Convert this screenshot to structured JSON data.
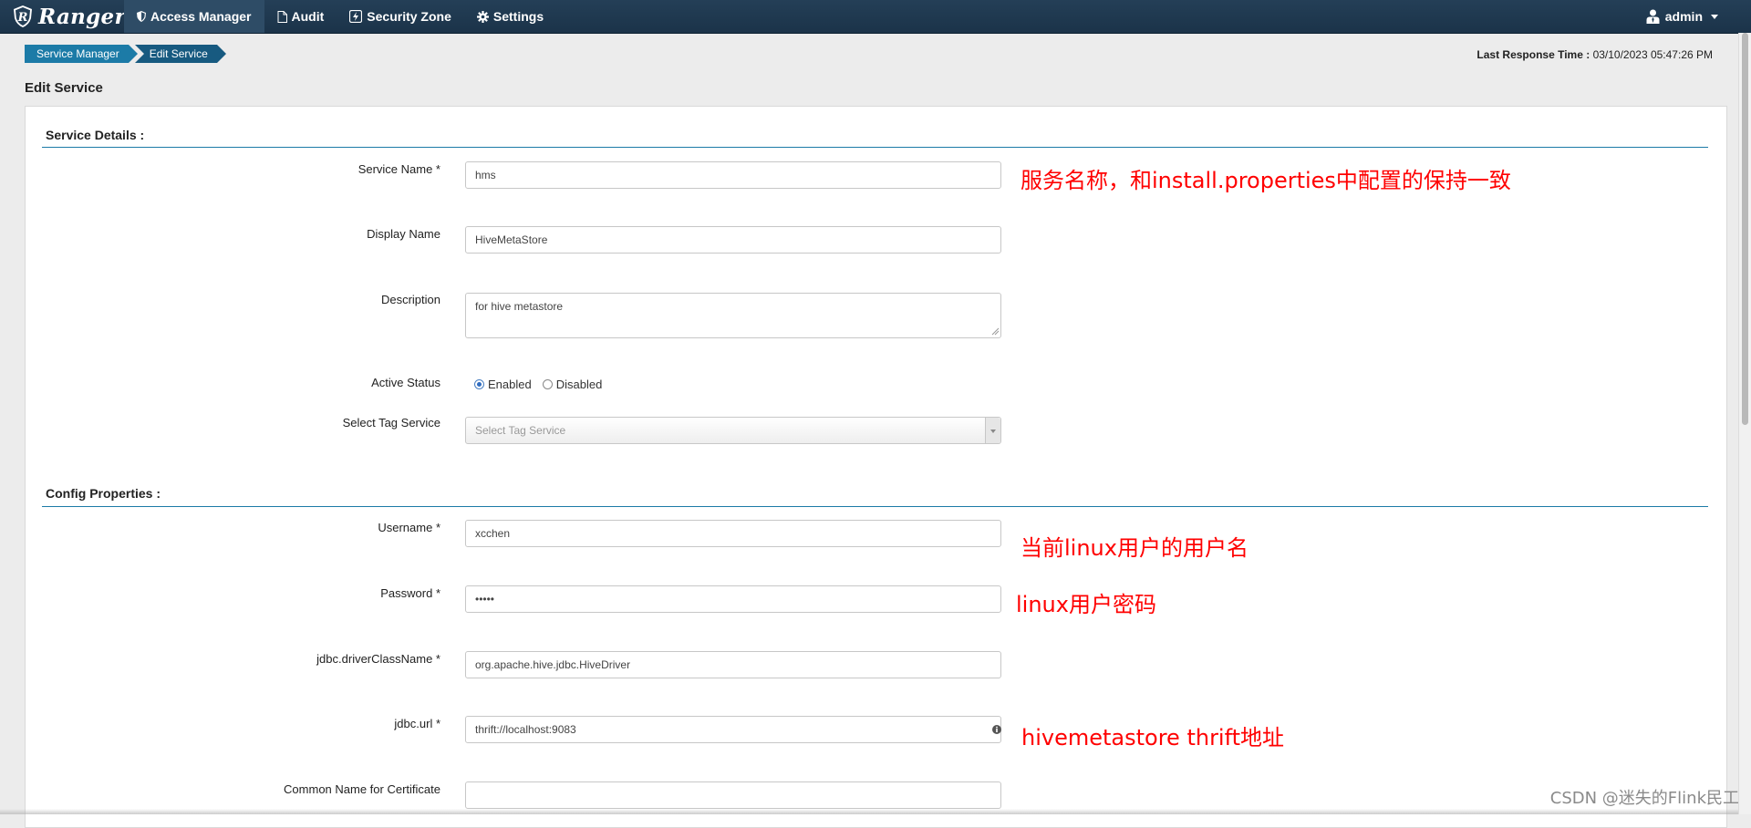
{
  "navbar": {
    "brand": "Ranger",
    "items": [
      {
        "label": "Access Manager",
        "icon": "shield-icon"
      },
      {
        "label": "Audit",
        "icon": "file-icon"
      },
      {
        "label": "Security Zone",
        "icon": "zone-icon"
      },
      {
        "label": "Settings",
        "icon": "gear-icon"
      }
    ],
    "user": "admin"
  },
  "breadcrumb": [
    "Service Manager",
    "Edit Service"
  ],
  "last_response": {
    "label": "Last Response Time :",
    "value": "03/10/2023 05:47:26 PM"
  },
  "page_title": "Edit Service",
  "service_details": {
    "title": "Service Details :",
    "service_name": {
      "label": "Service Name *",
      "value": "hms"
    },
    "display_name": {
      "label": "Display Name",
      "value": "HiveMetaStore"
    },
    "description": {
      "label": "Description",
      "value": "for hive metastore"
    },
    "active_status": {
      "label": "Active Status",
      "options": [
        "Enabled",
        "Disabled"
      ],
      "selected": "Enabled"
    },
    "tag_service": {
      "label": "Select Tag Service",
      "placeholder": "Select Tag Service"
    }
  },
  "config_properties": {
    "title": "Config Properties :",
    "username": {
      "label": "Username *",
      "value": "xcchen"
    },
    "password": {
      "label": "Password *",
      "value": "•••••"
    },
    "driver": {
      "label": "jdbc.driverClassName *",
      "value": "org.apache.hive.jdbc.HiveDriver"
    },
    "url": {
      "label": "jdbc.url *",
      "value": "thrift://localhost:9083"
    },
    "common_name": {
      "label": "Common Name for Certificate",
      "value": ""
    }
  },
  "annotations": {
    "service_name": "服务名称，和install.properties中配置的保持一致",
    "username": "当前linux用户的用户名",
    "password": "linux用户密码",
    "url": "hivemetastore thrift地址"
  },
  "watermark": "CSDN @迷失的Flink民工",
  "colors": {
    "navbar": "#1e3a52",
    "accent": "#1c7ba7",
    "annotation": "#ff0000"
  }
}
